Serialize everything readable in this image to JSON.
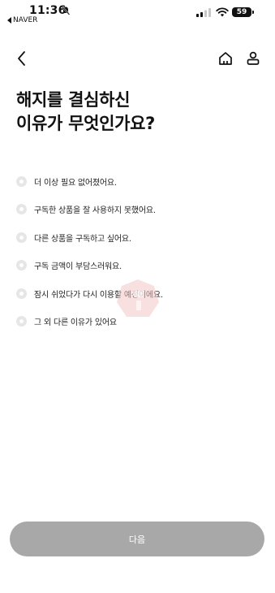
{
  "status_bar": {
    "time": "11:36",
    "back_app": "NAVER",
    "battery": "59"
  },
  "title": {
    "line1": "해지를 결심하신",
    "line2": "이유가 무엇인가요?"
  },
  "options": [
    {
      "label": "더 이상 필요 없어졌어요.",
      "selected": false
    },
    {
      "label": "구독한 상품을 잘 사용하지 못했어요.",
      "selected": false
    },
    {
      "label": "다른 상품을 구독하고 싶어요.",
      "selected": false
    },
    {
      "label": "구독 금액이 부담스러워요.",
      "selected": false
    },
    {
      "label": "잠시 쉬었다가 다시 이용할 예정이에요.",
      "selected": false
    },
    {
      "label": "그 외 다른 이유가 있어요",
      "selected": false
    }
  ],
  "next_button": {
    "label": "다음",
    "enabled": false
  },
  "colors": {
    "button_disabled": "#a8a8a8",
    "radio_unselected": "#e6e6e6",
    "watermark": "#f4c6c6"
  },
  "icons": {
    "back": "chevron-left-icon",
    "home": "home-icon",
    "user": "user-icon"
  }
}
